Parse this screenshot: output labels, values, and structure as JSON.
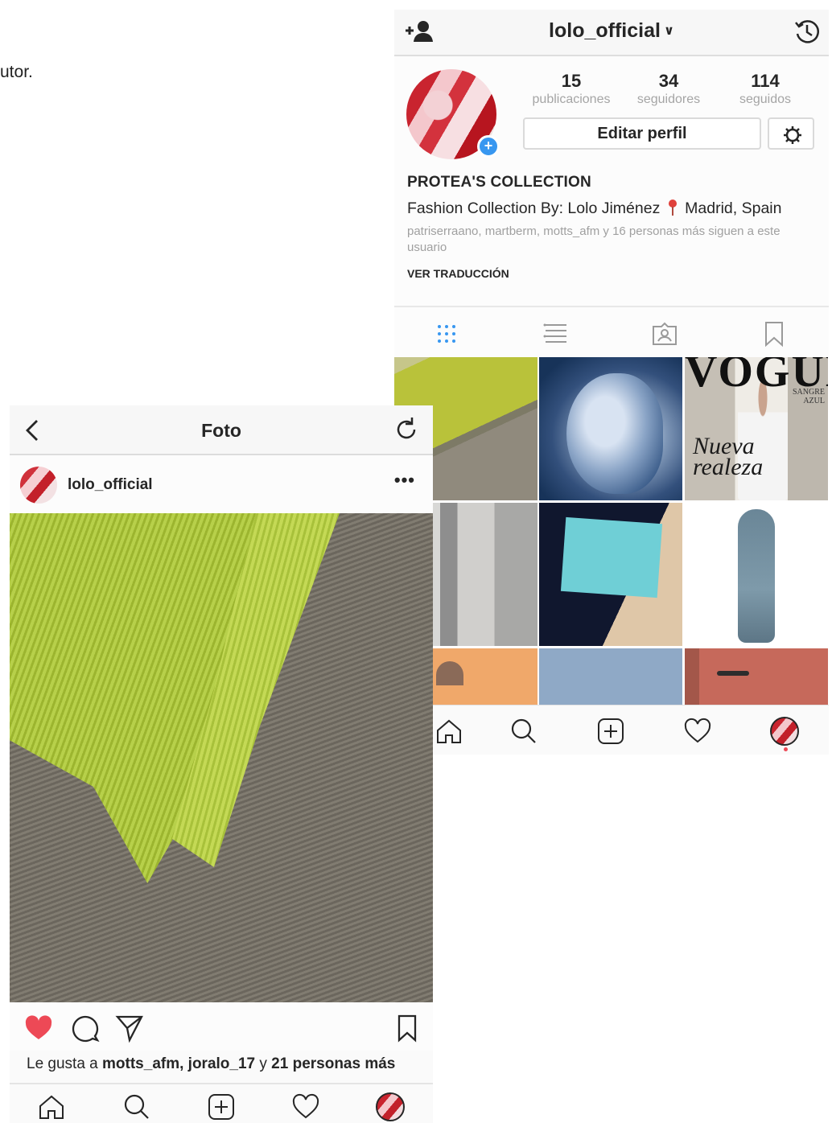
{
  "background_fragment": "utor.",
  "profile": {
    "username": "lolo_official",
    "stats": {
      "posts": {
        "value": "15",
        "label": "publicaciones"
      },
      "followers": {
        "value": "34",
        "label": "seguidores"
      },
      "following": {
        "value": "114",
        "label": "seguidos"
      }
    },
    "edit_button": "Editar perfil",
    "bio_name": "PROTEA'S COLLECTION",
    "bio_line_before_pin": "Fashion Collection By: Lolo Jiménez",
    "bio_line_after_pin": "Madrid, Spain",
    "followed_by": "patriserraano, martberm, motts_afm y 16 personas más siguen a este usuario",
    "translate": "VER TRADUCCIÓN",
    "grid": {
      "vogue_title": "VOGUE",
      "vogue_headline": "Nueva realeza",
      "vogue_side": "SANGRE AZUL"
    }
  },
  "photo": {
    "title": "Foto",
    "username": "lolo_official",
    "more": "•••",
    "likes_prefix": "Le gusta a ",
    "likes_users": "motts_afm, joralo_17",
    "likes_mid": " y ",
    "likes_count": "21 personas más"
  },
  "colors": {
    "like_red": "#ed4956",
    "accent_blue": "#3897f0",
    "text": "#262626",
    "muted": "#a5a5a5"
  },
  "icons": [
    "add-user-icon",
    "chevron-down-icon",
    "history-icon",
    "gear-icon",
    "grid-icon",
    "list-icon",
    "tagged-icon",
    "bookmark-icon",
    "home-icon",
    "search-icon",
    "add-post-icon",
    "heart-icon",
    "back-icon",
    "refresh-icon",
    "comment-icon",
    "share-icon"
  ]
}
